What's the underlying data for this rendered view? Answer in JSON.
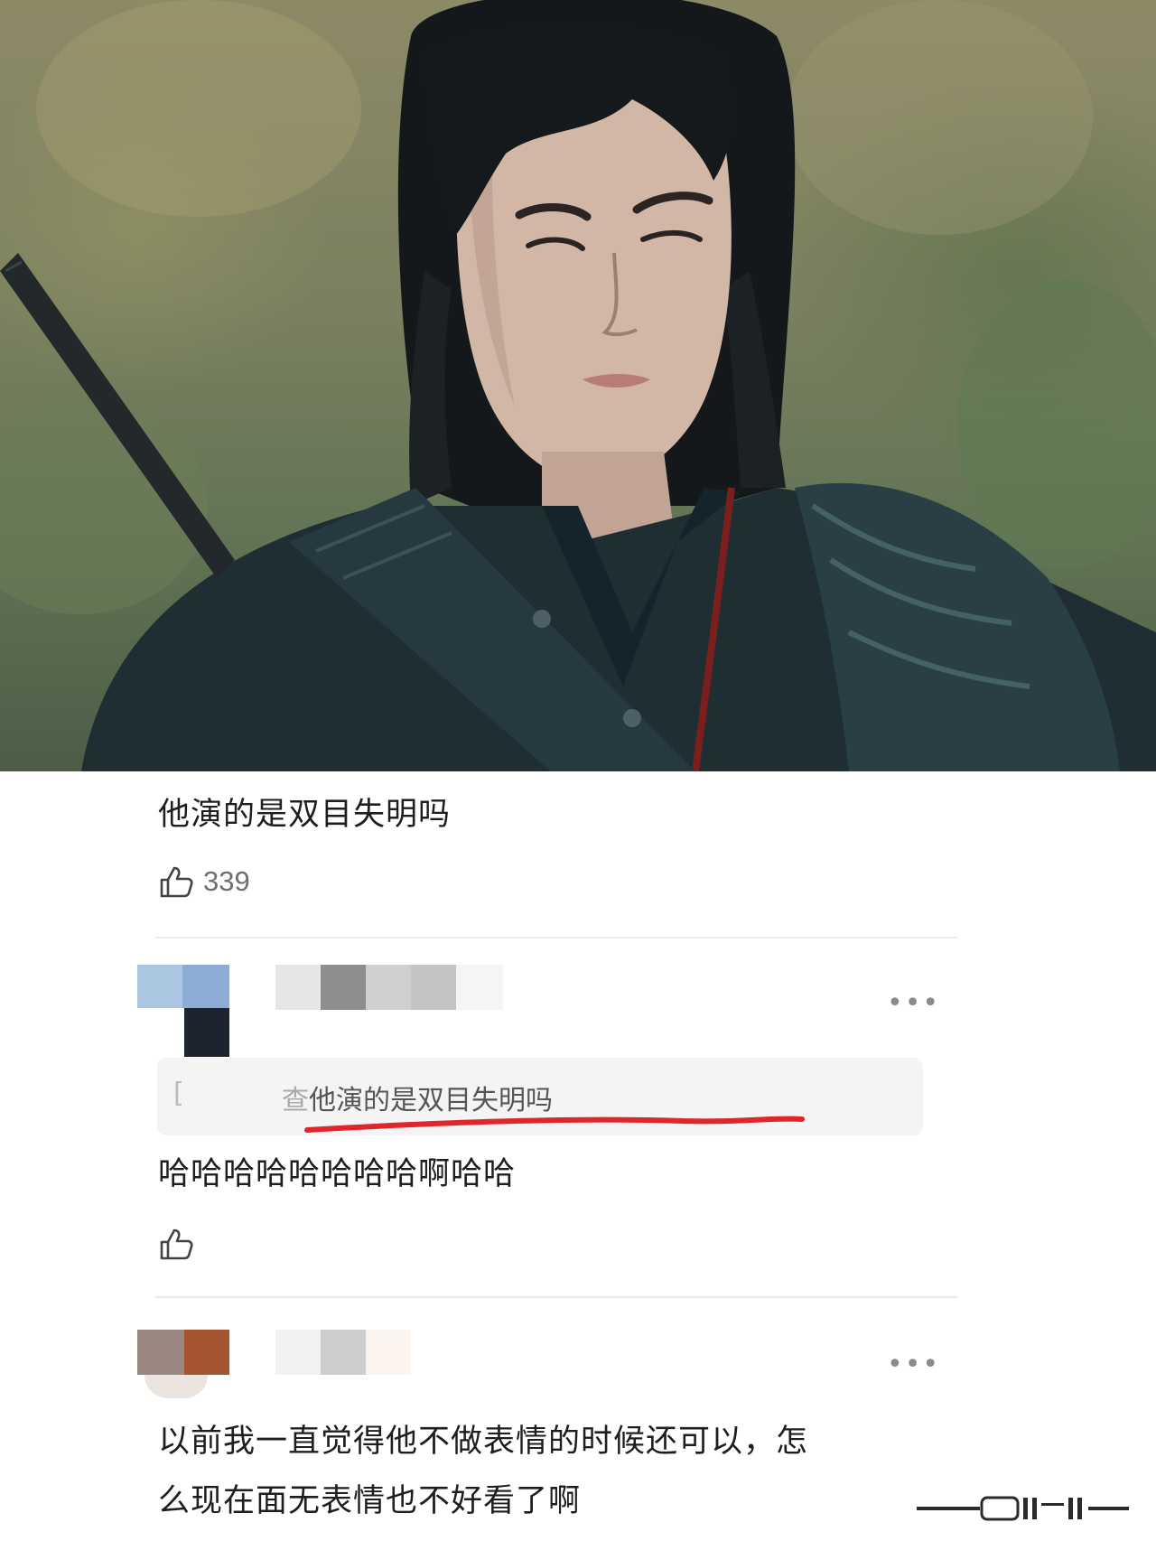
{
  "photo": {
    "icon": "drama-still-photo"
  },
  "comments": [
    {
      "text": "他演的是双目失明吗",
      "likes": "339"
    },
    {
      "quoted_prefix": "[",
      "quoted_prefix_tail": "查",
      "quoted_text": "他演的是双目失明吗",
      "text": "哈哈哈哈哈哈哈哈啊哈哈",
      "more": "•••"
    },
    {
      "text_line1": "以前我一直觉得他不做表情的时候还可以，怎",
      "text_line2": "么现在面无表情也不好看了啊",
      "more": "•••"
    }
  ],
  "colors": {
    "underline": "#e0262b",
    "divider": "#ebebeb"
  }
}
